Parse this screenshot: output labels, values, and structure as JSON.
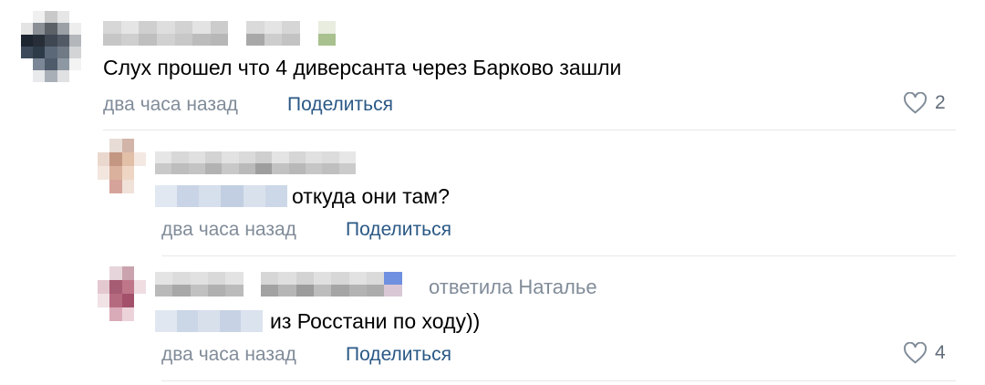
{
  "colors": {
    "text": "#000000",
    "meta": "#818c99",
    "share": "#2a5885",
    "divider": "#e7e8ec"
  },
  "comments": [
    {
      "text": "Слух прошел что 4 диверсанта через Барково зашли",
      "time": "два часа назад",
      "share_label": "Поделиться",
      "likes": "2",
      "like_icon": "heart-outline-icon"
    },
    {
      "text": "откуда они там?",
      "time": "два часа назад",
      "share_label": "Поделиться"
    },
    {
      "replied_to": "ответила Наталье",
      "text": "из Росстани по ходу))",
      "time": "два часа назад",
      "share_label": "Поделиться",
      "likes": "4",
      "like_icon": "heart-outline-icon"
    }
  ]
}
